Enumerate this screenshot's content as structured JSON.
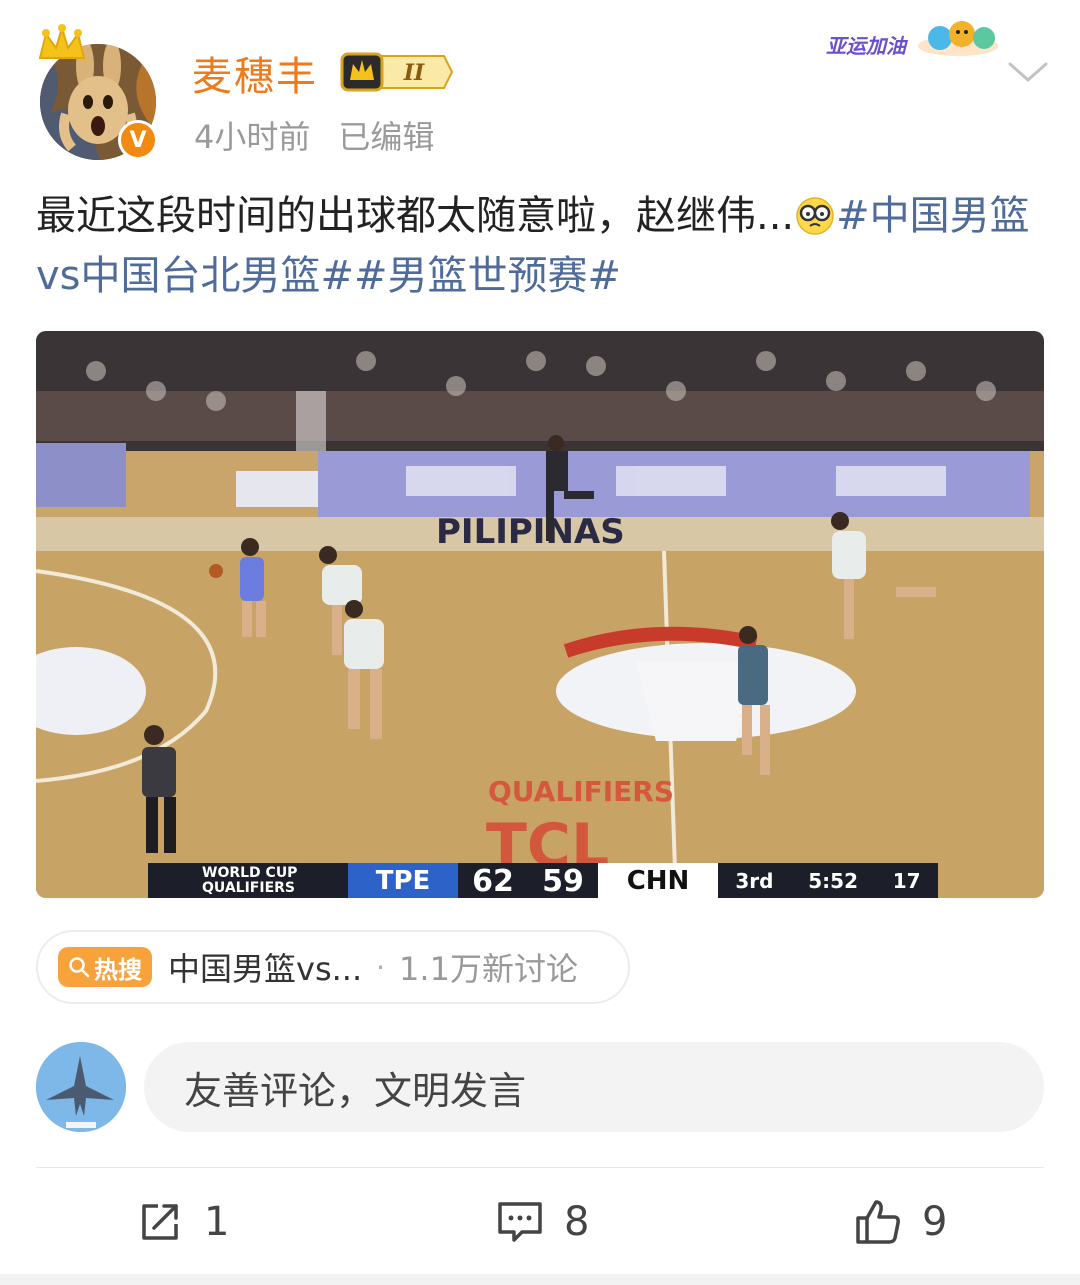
{
  "header": {
    "username": "麦穗丰",
    "level_badge": "II",
    "time": "4小时前",
    "edited": "已编辑",
    "verified_badge": "V",
    "asian_games_badge": "亚运加油"
  },
  "post": {
    "text": "最近这段时间的出球都太随意啦，赵继伟...",
    "emoji": "glasses-face-icon",
    "hashtags": [
      "#中国男篮vs中国台北男篮#",
      "#男篮世预赛#"
    ]
  },
  "video": {
    "court_text": [
      "PILIPINAS",
      "QUALIFIERS",
      "TCL"
    ],
    "scoreboard": {
      "event": [
        "WORLD CUP",
        "QUALIFIERS"
      ],
      "team_home": "TPE",
      "score_home": "62",
      "score_away": "59",
      "team_away": "CHN",
      "period": "3rd",
      "clock": "5:52",
      "shot_clock": "17"
    }
  },
  "hot_search": {
    "tag": "热搜",
    "title": "中国男篮vs...",
    "separator": "·",
    "count": "1.1万新讨论"
  },
  "comment": {
    "placeholder": "友善评论，文明发言"
  },
  "actions": {
    "repost_count": "1",
    "comment_count": "8",
    "like_count": "9"
  },
  "colors": {
    "username": "#ee7a1b",
    "hashtag": "#4f6b9a",
    "hot_tag": "#f8a23c",
    "tpe": "#2d63c8"
  }
}
